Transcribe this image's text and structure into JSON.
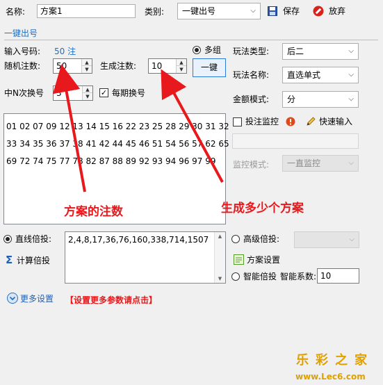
{
  "top": {
    "name_label": "名称:",
    "name_value": "方案1",
    "category_label": "类别:",
    "category_value": "一键出号",
    "save_label": "保存",
    "discard_label": "放弃"
  },
  "section": {
    "title": "一键出号"
  },
  "left": {
    "input_count_label": "输入号码:",
    "input_count_value": "50 注",
    "random_label": "随机注数:",
    "random_value": "50",
    "generate_label": "生成注数:",
    "generate_value": "10",
    "multi_group_label": "多组",
    "one_click_label": "一键",
    "change_label": "中N次换号",
    "change_value": "3",
    "each_period_label": "每期换号"
  },
  "numbers": {
    "lines": [
      "01 02 07 09 12 13 14 15 16 22 23 25 28 29 30 31 32",
      "33 34 35 36 37 38 41 42 44 45 46 51 54 56 57 62 65",
      "69 72 74 75 77 78 82 87 88 89 92 93 94 96 97 99"
    ]
  },
  "right": {
    "play_type_label": "玩法类型:",
    "play_type_value": "后二",
    "play_name_label": "玩法名称:",
    "play_name_value": "直选单式",
    "amount_label": "金额模式:",
    "amount_value": "分",
    "monitor_label": "投注监控",
    "quick_input_label": "快速输入",
    "monitor_mode_label": "监控模式:",
    "monitor_mode_value": "一直监控"
  },
  "annotations": {
    "left_text": "方案的注数",
    "right_text": "生成多少个方案"
  },
  "bottom": {
    "linear_label": "直线倍投:",
    "linear_value": "2,4,8,17,36,76,160,338,714,1507",
    "calc_label": "计算倍投",
    "advanced_label": "高级倍投:",
    "plan_settings_label": "方案设置",
    "smart_label": "智能倍投",
    "smart_coef_label": "智能系数:",
    "smart_coef_value": "10",
    "more_settings_label": "更多设置",
    "more_hint": "【设置更多参数请点击】"
  },
  "watermark": {
    "brand": "乐彩之家",
    "url": "www.Lec6.com"
  },
  "colors": {
    "accent_blue": "#1f6fbf",
    "annotation_red": "#e8191c",
    "discard_red": "#d9221c"
  }
}
